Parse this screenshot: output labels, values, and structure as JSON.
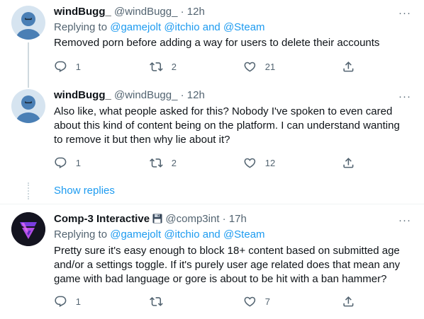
{
  "tweets": [
    {
      "name": "windBugg_",
      "handle": "@windBugg_",
      "dot": "·",
      "time": "12h",
      "replying_label": "Replying to",
      "mentions": [
        "@gamejolt",
        "@itchio",
        "@Steam"
      ],
      "and": "and",
      "text": "Removed porn before adding a way for users to delete their accounts",
      "reply_count": "1",
      "retweet_count": "2",
      "like_count": "21",
      "more": "···"
    },
    {
      "name": "windBugg_",
      "handle": "@windBugg_",
      "dot": "·",
      "time": "12h",
      "text": "Also like, what people asked for this? Nobody I've spoken to even cared about this kind of content being on the platform. I can understand wanting to remove it but then why lie about it?",
      "reply_count": "1",
      "retweet_count": "2",
      "like_count": "12",
      "more": "···"
    },
    {
      "name": "Comp-3 Interactive",
      "handle": "@comp3int",
      "dot": "·",
      "time": "17h",
      "replying_label": "Replying to",
      "mentions": [
        "@gamejolt",
        "@itchio",
        "@Steam"
      ],
      "and": "and",
      "text": "Pretty sure it's easy enough to block 18+ content based on submitted age and/or a settings toggle. If it's purely user age related does that mean any game with bad language or gore is about to be hit with a ban hammer?",
      "reply_count": "1",
      "retweet_count": "",
      "like_count": "7",
      "more": "···"
    }
  ],
  "show_replies": "Show replies",
  "icons": {
    "reply": "reply-icon",
    "retweet": "retweet-icon",
    "like": "heart-icon",
    "share": "share-icon",
    "more": "more-icon",
    "floppy": "floppy-disk-icon"
  },
  "colors": {
    "link": "#1d9bf0",
    "secondary": "#536471",
    "text": "#0f1419"
  }
}
